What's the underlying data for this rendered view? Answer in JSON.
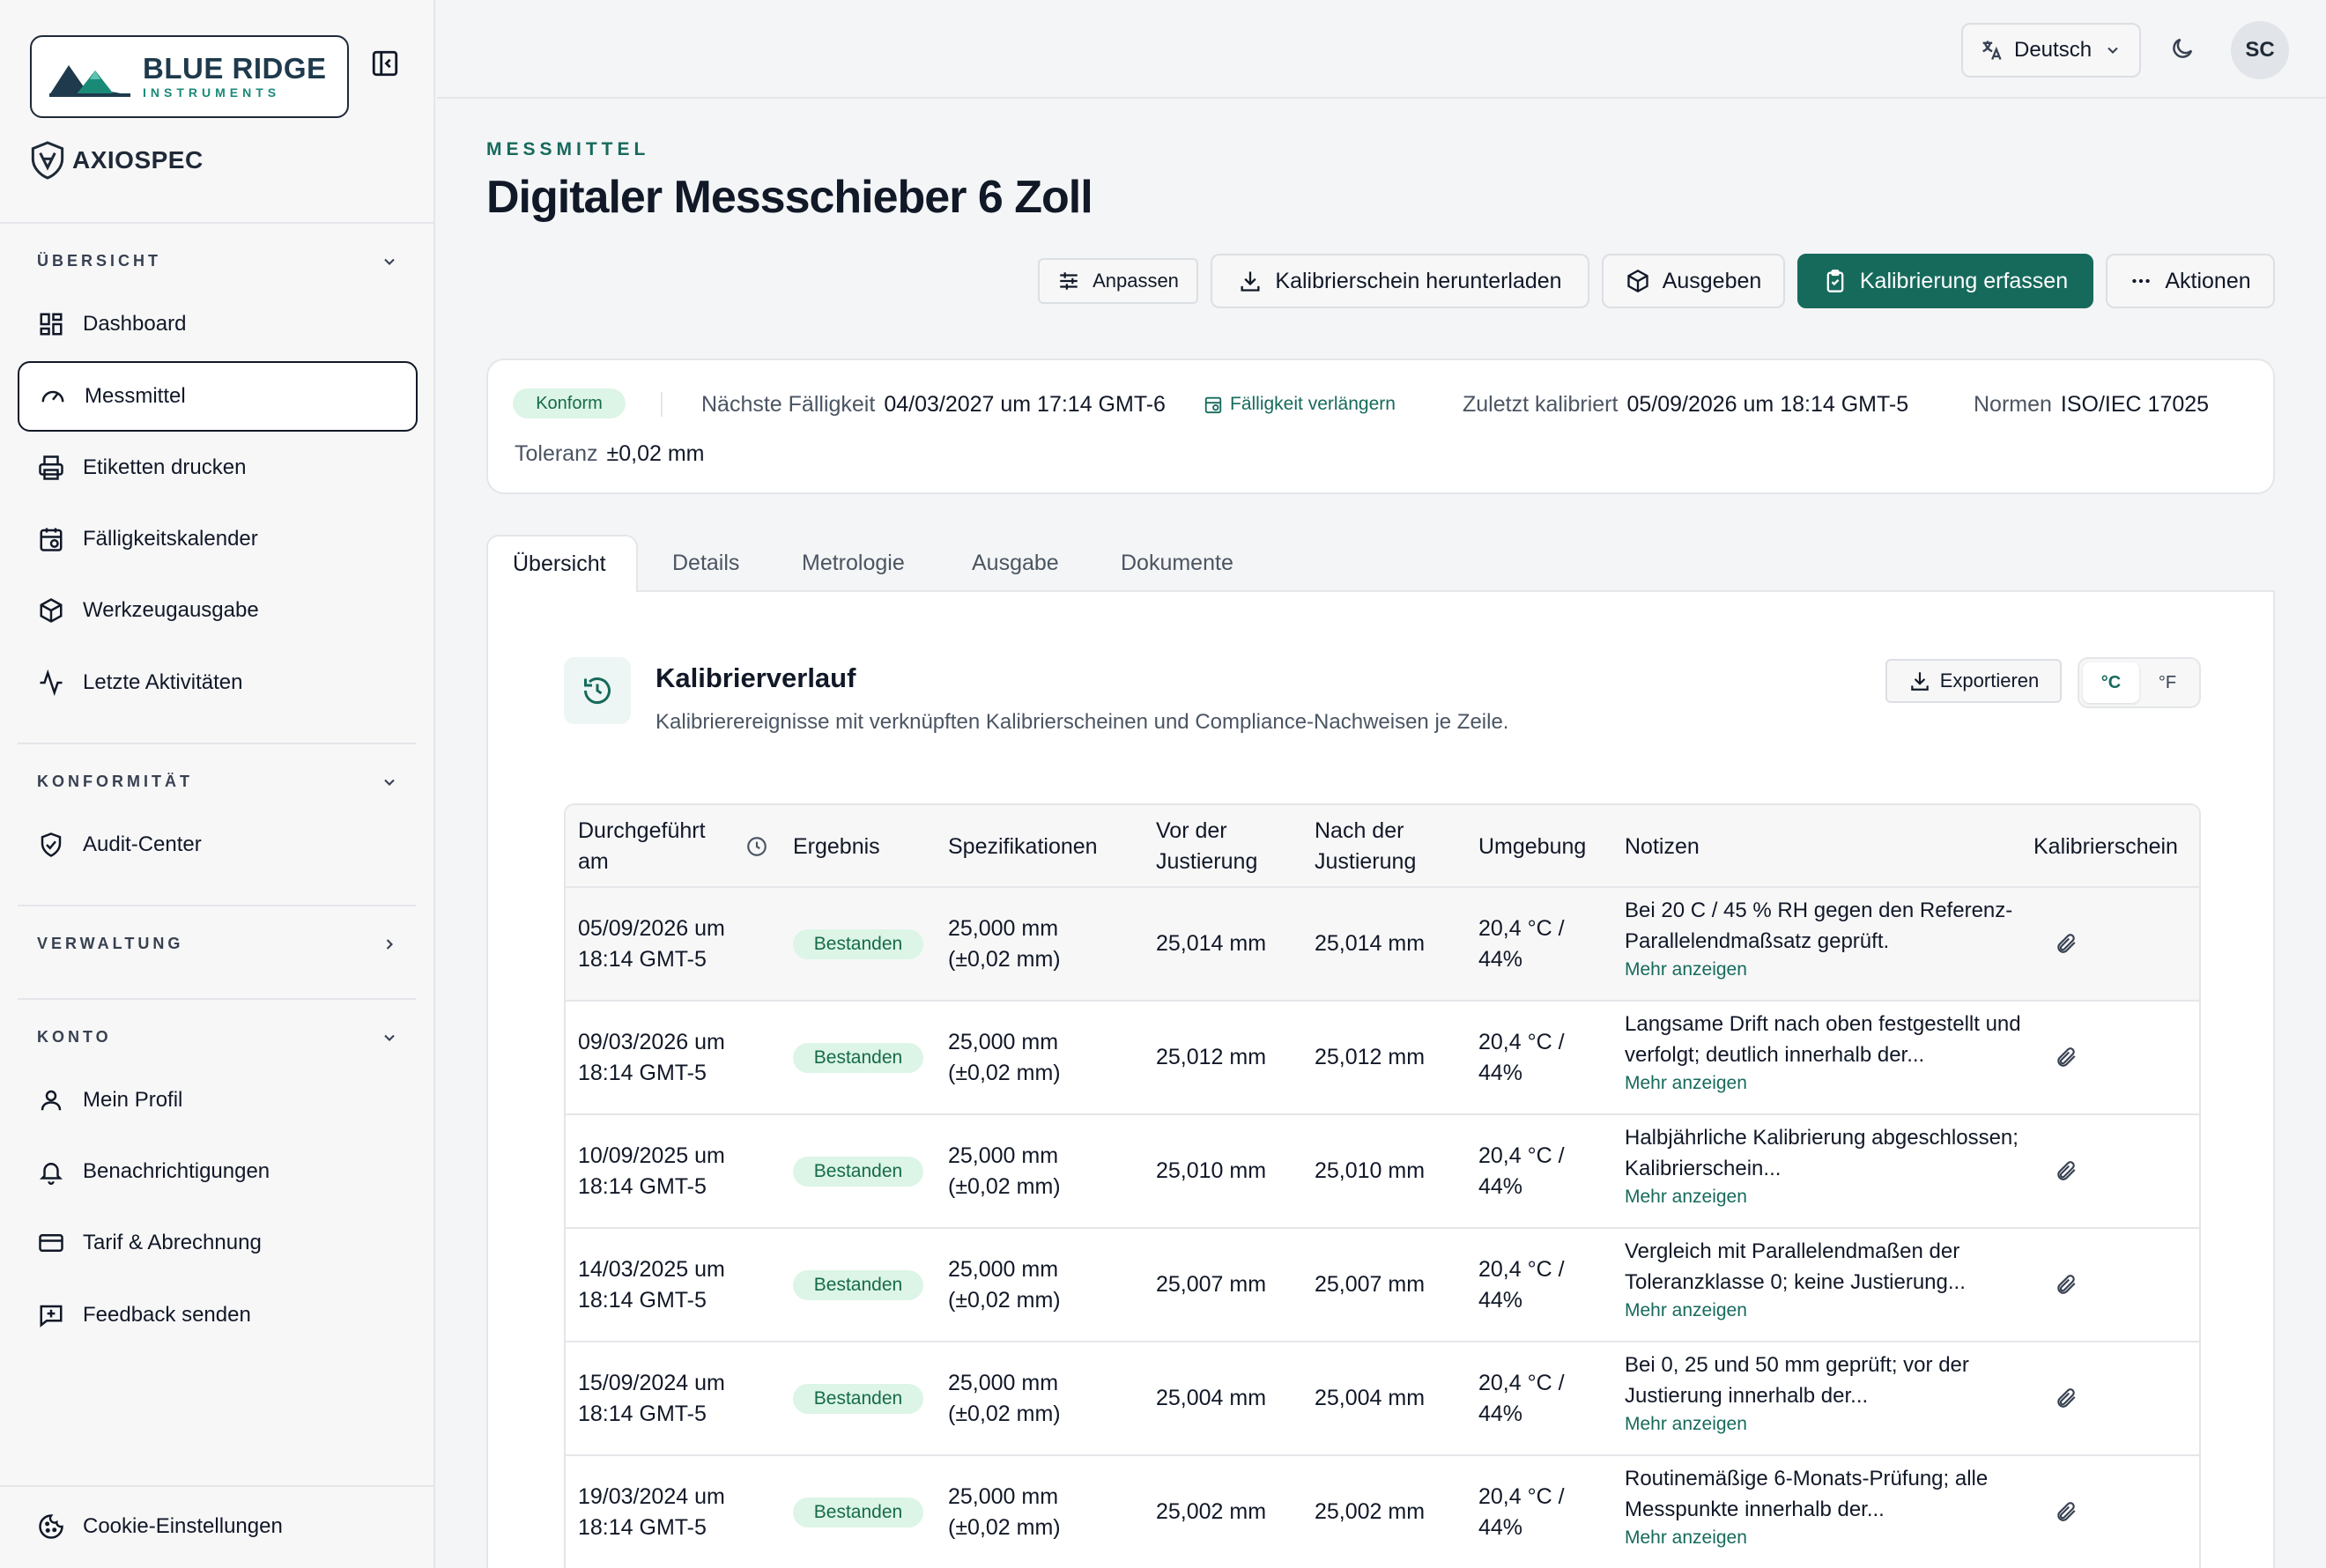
{
  "sidebar": {
    "brand_name": "BLUE RIDGE",
    "brand_sub": "INSTRUMENTS",
    "product_name": "AXIOSPEC",
    "sections": {
      "overview": "ÜBERSICHT",
      "compliance": "KONFORMITÄT",
      "admin": "VERWALTUNG",
      "account": "KONTO"
    },
    "items": {
      "dashboard": "Dashboard",
      "instruments": "Messmittel",
      "labels": "Etiketten drucken",
      "calendar": "Fälligkeitskalender",
      "tool_issue": "Werkzeugausgabe",
      "activity": "Letzte Aktivitäten",
      "audit": "Audit-Center",
      "profile": "Mein Profil",
      "notifications": "Benachrichtigungen",
      "billing": "Tarif & Abrechnung",
      "feedback": "Feedback senden",
      "cookies": "Cookie-Einstellungen"
    }
  },
  "topbar": {
    "language": "Deutsch",
    "avatar_initials": "SC"
  },
  "page": {
    "eyebrow": "MESSMITTEL",
    "title": "Digitaler Messschieber 6 Zoll",
    "actions": {
      "customize": "Anpassen",
      "download_cert": "Kalibrierschein herunterladen",
      "issue": "Ausgeben",
      "record_calibration": "Kalibrierung erfassen",
      "more": "Aktionen"
    }
  },
  "status": {
    "badge": "Konform",
    "next_due_label": "Nächste Fälligkeit",
    "next_due_value": "04/03/2027 um 17:14 GMT-6",
    "extend_label": "Fälligkeit verlängern",
    "last_cal_label": "Zuletzt kalibriert",
    "last_cal_value": "05/09/2026 um 18:14 GMT-5",
    "standards_label": "Normen",
    "standards_value": "ISO/IEC 17025",
    "tolerance_label": "Toleranz",
    "tolerance_value": "±0,02 mm"
  },
  "tabs": [
    "Übersicht",
    "Details",
    "Metrologie",
    "Ausgabe",
    "Dokumente"
  ],
  "history": {
    "title": "Kalibrierverlauf",
    "description": "Kalibrierereignisse mit verknüpften Kalibrierscheinen und Compliance-Nachweisen je Zeile.",
    "export_label": "Exportieren",
    "unit_c": "°C",
    "unit_f": "°F",
    "columns": {
      "performed": "Durchgeführt am",
      "result": "Ergebnis",
      "specs": "Spezifikationen",
      "before": "Vor der Justierung",
      "after": "Nach der Justierung",
      "environment": "Umgebung",
      "notes": "Notizen",
      "certificate": "Kalibrierschein"
    },
    "more_label": "Mehr anzeigen",
    "rows": [
      {
        "date": "05/09/2026 um 18:14 GMT-5",
        "result": "Bestanden",
        "spec": "25,000 mm (±0,02 mm)",
        "before": "25,014 mm",
        "after": "25,014 mm",
        "env": "20,4 °C / 44%",
        "notes": "Bei 20 C / 45 % RH gegen den Referenz-Parallelendmaßsatz geprüft."
      },
      {
        "date": "09/03/2026 um 18:14 GMT-5",
        "result": "Bestanden",
        "spec": "25,000 mm (±0,02 mm)",
        "before": "25,012 mm",
        "after": "25,012 mm",
        "env": "20,4 °C / 44%",
        "notes": "Langsame Drift nach oben festgestellt und verfolgt; deutlich innerhalb der..."
      },
      {
        "date": "10/09/2025 um 18:14 GMT-5",
        "result": "Bestanden",
        "spec": "25,000 mm (±0,02 mm)",
        "before": "25,010 mm",
        "after": "25,010 mm",
        "env": "20,4 °C / 44%",
        "notes": "Halbjährliche Kalibrierung abgeschlossen; Kalibrierschein..."
      },
      {
        "date": "14/03/2025 um 18:14 GMT-5",
        "result": "Bestanden",
        "spec": "25,000 mm (±0,02 mm)",
        "before": "25,007 mm",
        "after": "25,007 mm",
        "env": "20,4 °C / 44%",
        "notes": "Vergleich mit Parallelendmaßen der Toleranzklasse 0; keine Justierung..."
      },
      {
        "date": "15/09/2024 um 18:14 GMT-5",
        "result": "Bestanden",
        "spec": "25,000 mm (±0,02 mm)",
        "before": "25,004 mm",
        "after": "25,004 mm",
        "env": "20,4 °C / 44%",
        "notes": "Bei 0, 25 und 50 mm geprüft; vor der Justierung innerhalb der..."
      },
      {
        "date": "19/03/2024 um 18:14 GMT-5",
        "result": "Bestanden",
        "spec": "25,000 mm (±0,02 mm)",
        "before": "25,002 mm",
        "after": "25,002 mm",
        "env": "20,4 °C / 44%",
        "notes": "Routinemäßige 6-Monats-Prüfung; alle Messpunkte innerhalb der..."
      }
    ]
  },
  "colors": {
    "accent": "#166a5c",
    "badge_bg": "#dcf5e6",
    "border": "#e4e6e9"
  }
}
